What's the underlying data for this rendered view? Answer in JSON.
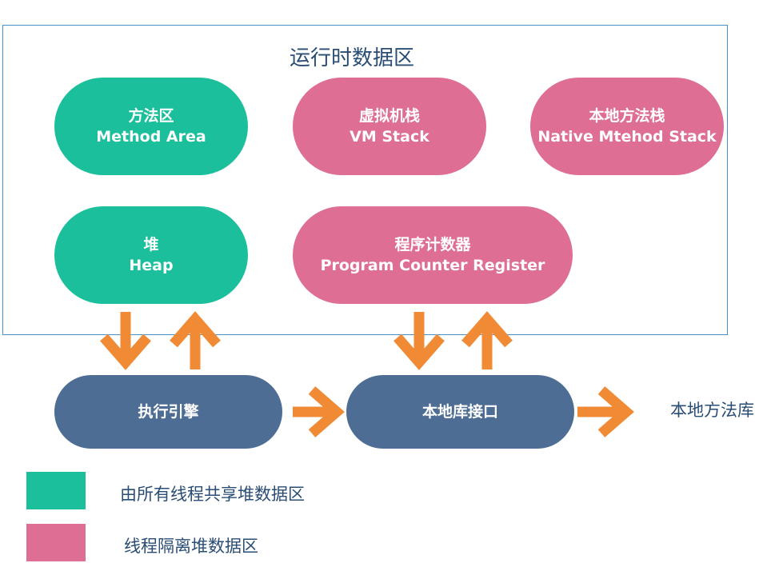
{
  "diagram": {
    "title": "运行时数据区",
    "areas": {
      "method_area": {
        "zh": "方法区",
        "en": "Method Area"
      },
      "vm_stack": {
        "zh": "虚拟机栈",
        "en": "VM Stack"
      },
      "native_method_stack": {
        "zh": "本地方法栈",
        "en": "Native Mtehod Stack"
      },
      "heap": {
        "zh": "堆",
        "en": "Heap"
      },
      "pc_register": {
        "zh": "程序计数器",
        "en": "Program Counter Register"
      }
    },
    "execution_engine": "执行引擎",
    "native_interface": "本地库接口",
    "native_library": "本地方法库"
  },
  "legend": {
    "shared": {
      "label": "由所有线程共享堆数据区",
      "color": "#1cbf9c"
    },
    "isolated": {
      "label": "线程隔离堆数据区",
      "color": "#de6e93"
    }
  },
  "colors": {
    "shared": "#1cbf9c",
    "isolated": "#de6e93",
    "component": "#4d6d94",
    "arrow": "#f08a34",
    "frame": "#4a90c8",
    "text": "#2a4d75"
  },
  "icons": {
    "down_arrow": "arrow-down-icon",
    "up_arrow": "arrow-up-icon",
    "right_arrow": "arrow-right-icon"
  }
}
